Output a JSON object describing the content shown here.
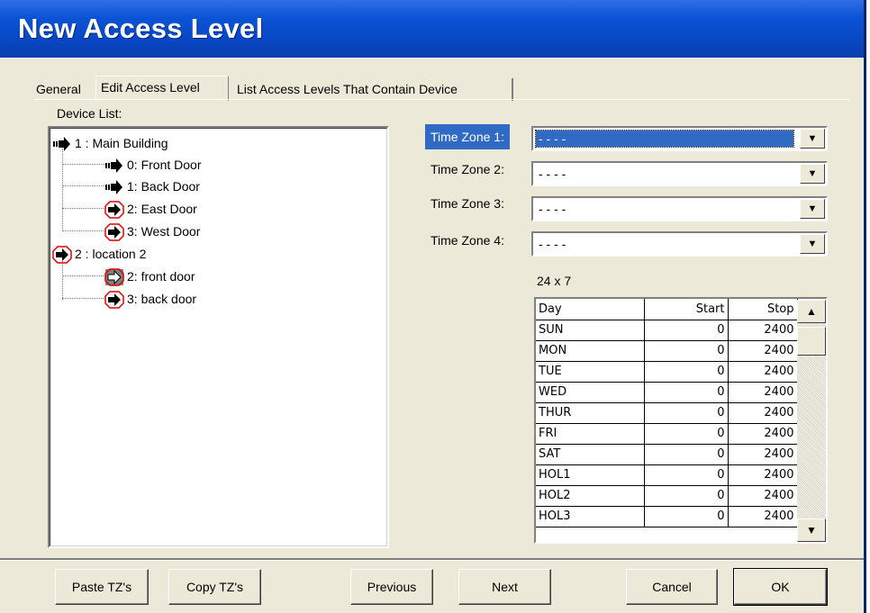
{
  "window": {
    "title": "New Access Level"
  },
  "tabs": [
    {
      "label": "General"
    },
    {
      "label": "Edit Access Level"
    },
    {
      "label": "List Access Levels That Contain Device"
    }
  ],
  "device_list": {
    "label": "Device List:",
    "nodes": [
      {
        "label": "1 : Main Building",
        "icon": "arrow-icon"
      },
      {
        "label": "0: Front Door",
        "icon": "arrow-icon"
      },
      {
        "label": "1: Back Door",
        "icon": "arrow-icon"
      },
      {
        "label": "2: East Door",
        "icon": "arrow-denied-icon"
      },
      {
        "label": "3: West Door",
        "icon": "arrow-denied-icon"
      },
      {
        "label": "2 : location 2",
        "icon": "arrow-denied-icon"
      },
      {
        "label": "2: front door",
        "icon": "arrow-disabled-icon"
      },
      {
        "label": "3: back door",
        "icon": "arrow-denied-icon"
      }
    ]
  },
  "time_zones": [
    {
      "label": "Time Zone 1:",
      "value": "- - - -"
    },
    {
      "label": "Time Zone 2:",
      "value": "- - - -"
    },
    {
      "label": "Time Zone 3:",
      "value": "- - - -"
    },
    {
      "label": "Time Zone 4:",
      "value": "- - - -"
    }
  ],
  "schedule": {
    "caption": "24 x 7",
    "headers": [
      "Day",
      "Start",
      "Stop"
    ],
    "rows": [
      [
        "SUN",
        "0",
        "2400"
      ],
      [
        "MON",
        "0",
        "2400"
      ],
      [
        "TUE",
        "0",
        "2400"
      ],
      [
        "WED",
        "0",
        "2400"
      ],
      [
        "THUR",
        "0",
        "2400"
      ],
      [
        "FRI",
        "0",
        "2400"
      ],
      [
        "SAT",
        "0",
        "2400"
      ],
      [
        "HOL1",
        "0",
        "2400"
      ],
      [
        "HOL2",
        "0",
        "2400"
      ],
      [
        "HOL3",
        "0",
        "2400"
      ]
    ]
  },
  "buttons": {
    "paste": "Paste TZ's",
    "copy": "Copy TZ's",
    "previous": "Previous",
    "next": "Next",
    "cancel": "Cancel",
    "ok": "OK"
  },
  "colors": {
    "titlebar": "#0b54d6",
    "selection": "#316ac5",
    "face": "#ece9d8"
  }
}
